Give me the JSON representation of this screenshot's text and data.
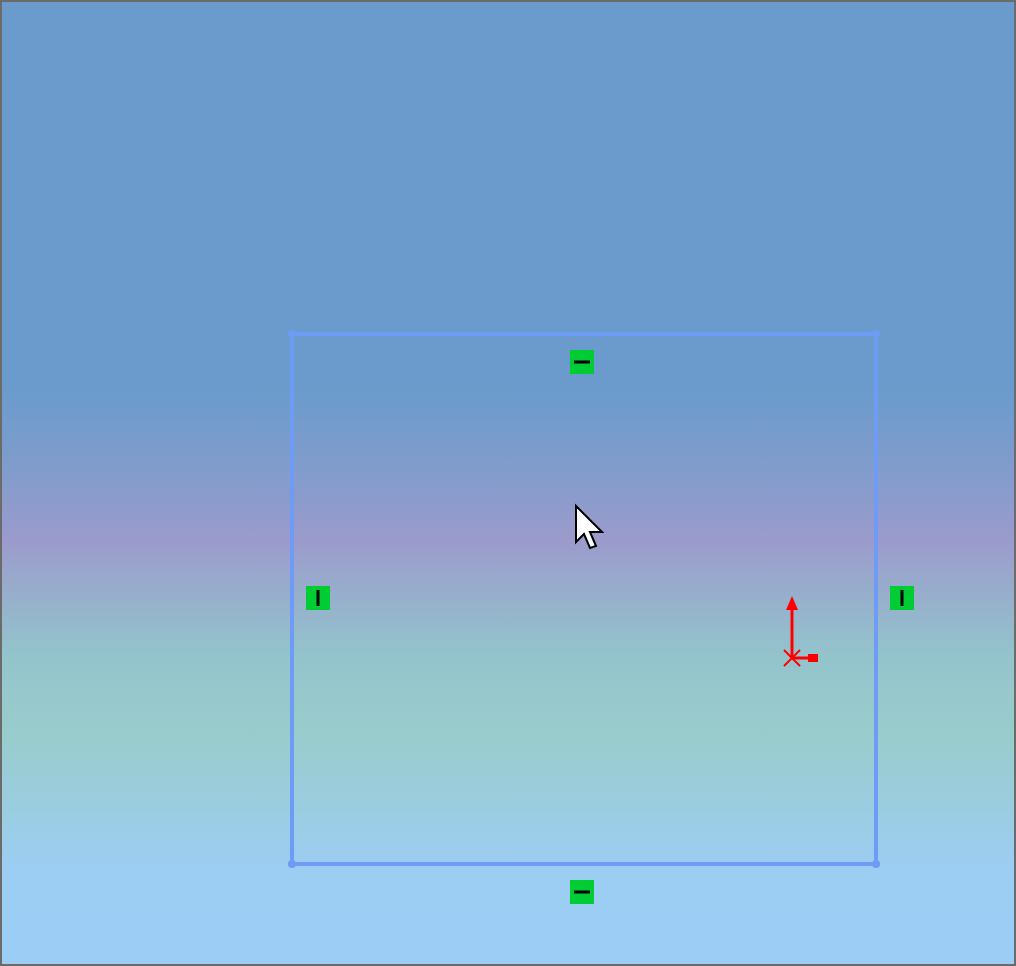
{
  "sketch": {
    "relations": [
      {
        "kind": "horizontal"
      },
      {
        "kind": "vertical"
      },
      {
        "kind": "vertical"
      },
      {
        "kind": "horizontal"
      }
    ]
  }
}
